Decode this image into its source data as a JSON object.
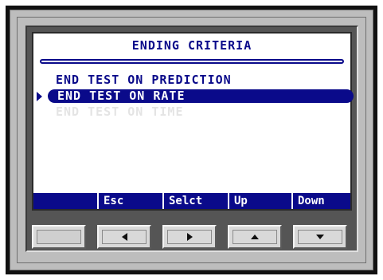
{
  "screen": {
    "title": "ENDING CRITERIA",
    "menu": [
      {
        "label": "END TEST ON PREDICTION",
        "state": "normal"
      },
      {
        "label": "END TEST ON RATE",
        "state": "selected"
      },
      {
        "label": "END TEST ON TIME",
        "state": "disabled"
      }
    ],
    "softkeys": [
      "",
      "Esc",
      "Selct",
      "Up",
      "Down"
    ]
  },
  "buttons": [
    {
      "icon": "blank-icon"
    },
    {
      "icon": "left-arrow-icon"
    },
    {
      "icon": "right-arrow-icon"
    },
    {
      "icon": "up-arrow-icon"
    },
    {
      "icon": "down-arrow-icon"
    }
  ],
  "colors": {
    "lcd_text": "#0a0a8a",
    "lcd_background": "#ffffff",
    "bezel": "#bdbdbd",
    "frame": "#111111"
  }
}
